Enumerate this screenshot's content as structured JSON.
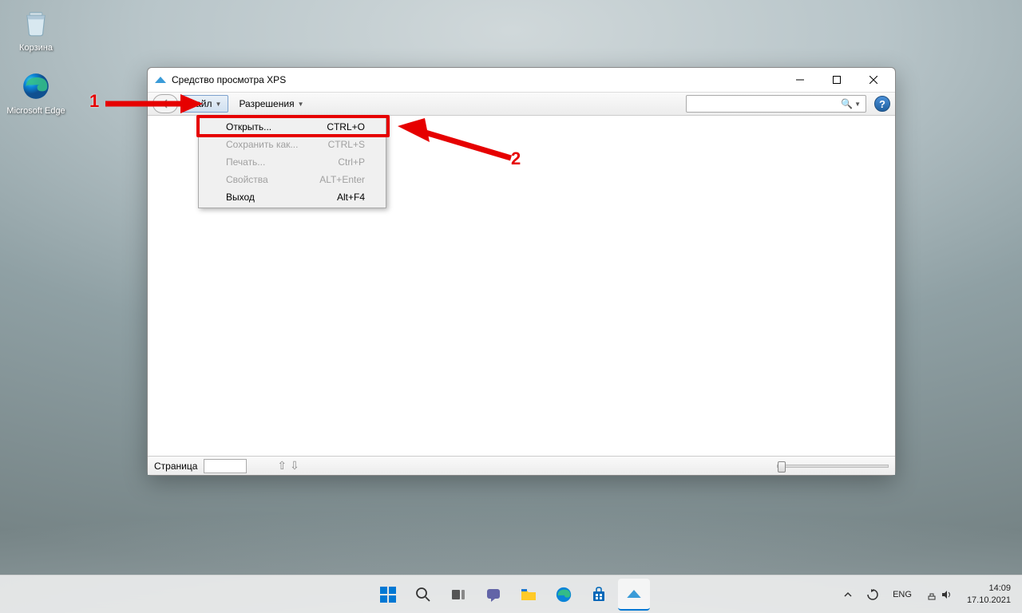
{
  "desktop": {
    "icons": [
      {
        "label": "Корзина"
      },
      {
        "label": "Microsoft Edge"
      }
    ]
  },
  "window": {
    "title": "Средство просмотра XPS",
    "menu": {
      "file": "Файл",
      "permissions": "Разрешения"
    },
    "dropdown": [
      {
        "label": "Открыть...",
        "shortcut": "CTRL+O",
        "disabled": false
      },
      {
        "label": "Сохранить как...",
        "shortcut": "CTRL+S",
        "disabled": true
      },
      {
        "label": "Печать...",
        "shortcut": "Ctrl+P",
        "disabled": true
      },
      {
        "label": "Свойства",
        "shortcut": "ALT+Enter",
        "disabled": true
      },
      {
        "label": "Выход",
        "shortcut": "Alt+F4",
        "disabled": false
      }
    ],
    "status": {
      "page_label": "Страница"
    }
  },
  "annotations": {
    "one": "1",
    "two": "2"
  },
  "taskbar": {
    "lang": "ENG",
    "time": "14:09",
    "date": "17.10.2021"
  }
}
